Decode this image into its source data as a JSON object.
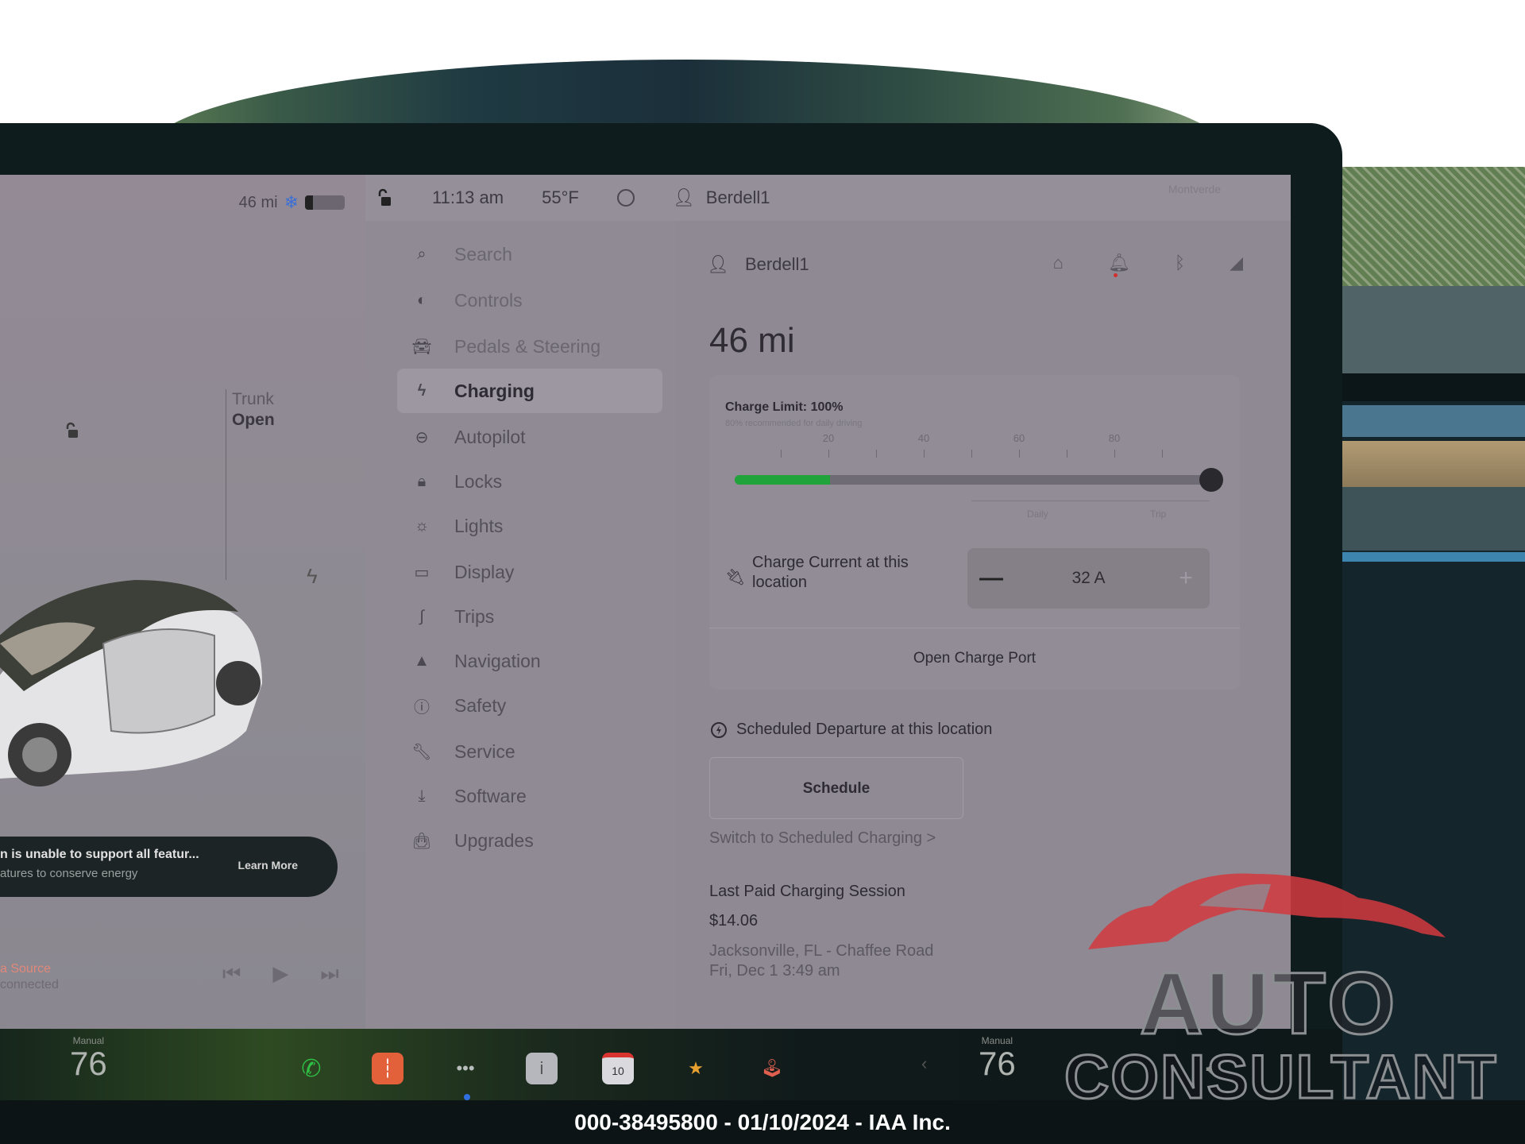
{
  "car_pane": {
    "range": "46 mi",
    "battery_level_percent": 20,
    "trunk_label": "Trunk",
    "trunk_state": "Open",
    "notice_title": "n is unable to support all featur...",
    "notice_body": "atures to conserve energy",
    "notice_action": "Learn More",
    "media_source": "a Source",
    "media_status": "connected"
  },
  "topbar": {
    "time": "11:13 am",
    "temperature": "55°F",
    "user": "Berdell1",
    "faint_text": "Montverde"
  },
  "nav": {
    "items": [
      {
        "label": "Search",
        "icon": "search-icon"
      },
      {
        "label": "Controls",
        "icon": "toggle-icon"
      },
      {
        "label": "Pedals & Steering",
        "icon": "car-icon"
      },
      {
        "label": "Charging",
        "icon": "bolt-icon",
        "active": true
      },
      {
        "label": "Autopilot",
        "icon": "steering-wheel-icon"
      },
      {
        "label": "Locks",
        "icon": "lock-icon"
      },
      {
        "label": "Lights",
        "icon": "light-icon"
      },
      {
        "label": "Display",
        "icon": "display-icon"
      },
      {
        "label": "Trips",
        "icon": "trips-icon"
      },
      {
        "label": "Navigation",
        "icon": "navigation-arrow-icon"
      },
      {
        "label": "Safety",
        "icon": "alert-circle-icon"
      },
      {
        "label": "Service",
        "icon": "wrench-icon"
      },
      {
        "label": "Software",
        "icon": "download-icon"
      },
      {
        "label": "Upgrades",
        "icon": "shopping-bag-icon"
      }
    ]
  },
  "charging": {
    "profile_name": "Berdell1",
    "range": "46 mi",
    "charge_limit_label": "Charge Limit: 100%",
    "charge_limit_percent": 100,
    "current_charge_percent": 20,
    "recommendation": "80% recommended for daily driving",
    "tick_labels": [
      "20",
      "40",
      "60",
      "80"
    ],
    "zone_labels": [
      "Daily",
      "Trip"
    ],
    "current_label": "Charge Current at this location",
    "current_value": "32 A",
    "minus_label": "—",
    "plus_label": "+",
    "open_charge_port": "Open Charge Port",
    "departure_label": "Scheduled Departure at this location",
    "schedule_button": "Schedule",
    "switch_link": "Switch to Scheduled Charging >",
    "last_session_title": "Last Paid Charging Session",
    "last_session_price": "$14.06",
    "last_session_location": "Jacksonville, FL - Chaffee Road",
    "last_session_time": "Fri, Dec 1 3:49 am"
  },
  "dock": {
    "left_climate_label": "Manual",
    "left_temp": "76",
    "right_climate_label": "Manual",
    "right_temp": "76",
    "calendar_day": "10",
    "apps": [
      "phone",
      "voice",
      "more",
      "notes",
      "calendar",
      "toybox",
      "arcade"
    ]
  },
  "caption": "000-38495800 - 01/10/2024 - IAA Inc.",
  "watermark": {
    "line1": "AUTO",
    "line2": "CONSULTANT"
  }
}
